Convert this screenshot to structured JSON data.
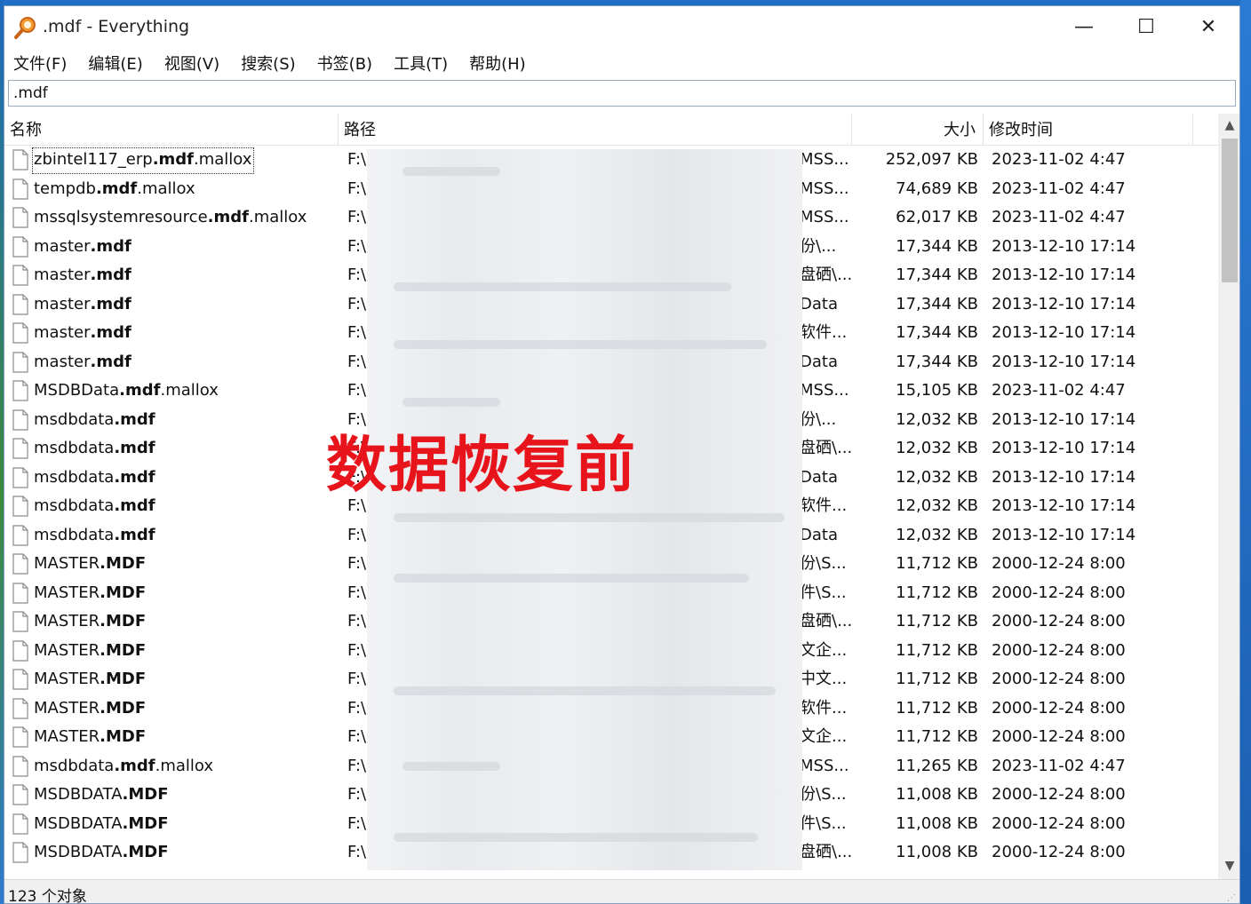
{
  "window": {
    "title": ".mdf - Everything",
    "controls": {
      "minimize": "—",
      "maximize": "☐",
      "close": "✕"
    }
  },
  "menu": [
    "文件(F)",
    "编辑(E)",
    "视图(V)",
    "搜索(S)",
    "书签(B)",
    "工具(T)",
    "帮助(H)"
  ],
  "search": {
    "value": ".mdf"
  },
  "columns": {
    "name": "名称",
    "path": "路径",
    "size": "大小",
    "modified": "修改时间"
  },
  "rows": [
    {
      "pre": "zbintel117_erp",
      "bold": ".mdf",
      "post": ".mallox",
      "drive": "F:\\",
      "tail": "MSS...",
      "size": "252,097 KB",
      "date": "2023-11-02 4:47"
    },
    {
      "pre": "tempdb",
      "bold": ".mdf",
      "post": ".mallox",
      "drive": "F:\\",
      "tail": "MSS...",
      "size": "74,689 KB",
      "date": "2023-11-02 4:47"
    },
    {
      "pre": "mssqlsystemresource",
      "bold": ".mdf",
      "post": ".mallox",
      "drive": "F:\\",
      "tail": "MSS...",
      "size": "62,017 KB",
      "date": "2023-11-02 4:47"
    },
    {
      "pre": "master",
      "bold": ".mdf",
      "post": "",
      "drive": "F:\\",
      "tail": "份\\...",
      "size": "17,344 KB",
      "date": "2013-12-10 17:14"
    },
    {
      "pre": "master",
      "bold": ".mdf",
      "post": "",
      "drive": "F:\\",
      "tail": "盘硒\\...",
      "size": "17,344 KB",
      "date": "2013-12-10 17:14"
    },
    {
      "pre": "master",
      "bold": ".mdf",
      "post": "",
      "drive": "F:\\",
      "tail": "Data",
      "size": "17,344 KB",
      "date": "2013-12-10 17:14"
    },
    {
      "pre": "master",
      "bold": ".mdf",
      "post": "",
      "drive": "F:\\",
      "tail": "软件...",
      "size": "17,344 KB",
      "date": "2013-12-10 17:14"
    },
    {
      "pre": "master",
      "bold": ".mdf",
      "post": "",
      "drive": "F:\\",
      "tail": "Data",
      "size": "17,344 KB",
      "date": "2013-12-10 17:14"
    },
    {
      "pre": "MSDBData",
      "bold": ".mdf",
      "post": ".mallox",
      "drive": "F:\\",
      "tail": "MSS...",
      "size": "15,105 KB",
      "date": "2023-11-02 4:47"
    },
    {
      "pre": "msdbdata",
      "bold": ".mdf",
      "post": "",
      "drive": "F:\\",
      "tail": "份\\...",
      "size": "12,032 KB",
      "date": "2013-12-10 17:14"
    },
    {
      "pre": "msdbdata",
      "bold": ".mdf",
      "post": "",
      "drive": "F:\\",
      "tail": "盘硒\\...",
      "size": "12,032 KB",
      "date": "2013-12-10 17:14"
    },
    {
      "pre": "msdbdata",
      "bold": ".mdf",
      "post": "",
      "drive": "F:\\",
      "tail": "Data",
      "size": "12,032 KB",
      "date": "2013-12-10 17:14"
    },
    {
      "pre": "msdbdata",
      "bold": ".mdf",
      "post": "",
      "drive": "F:\\",
      "tail": "软件...",
      "size": "12,032 KB",
      "date": "2013-12-10 17:14"
    },
    {
      "pre": "msdbdata",
      "bold": ".mdf",
      "post": "",
      "drive": "F:\\",
      "tail": "Data",
      "size": "12,032 KB",
      "date": "2013-12-10 17:14"
    },
    {
      "pre": "MASTER",
      "bold": ".MDF",
      "post": "",
      "drive": "F:\\",
      "tail": "份\\S...",
      "size": "11,712 KB",
      "date": "2000-12-24 8:00"
    },
    {
      "pre": "MASTER",
      "bold": ".MDF",
      "post": "",
      "drive": "F:\\",
      "tail": "件\\S...",
      "size": "11,712 KB",
      "date": "2000-12-24 8:00"
    },
    {
      "pre": "MASTER",
      "bold": ".MDF",
      "post": "",
      "drive": "F:\\",
      "tail": "盘硒\\...",
      "size": "11,712 KB",
      "date": "2000-12-24 8:00"
    },
    {
      "pre": "MASTER",
      "bold": ".MDF",
      "post": "",
      "drive": "F:\\",
      "tail": "文企...",
      "size": "11,712 KB",
      "date": "2000-12-24 8:00"
    },
    {
      "pre": "MASTER",
      "bold": ".MDF",
      "post": "",
      "drive": "F:\\",
      "tail": "中文...",
      "size": "11,712 KB",
      "date": "2000-12-24 8:00"
    },
    {
      "pre": "MASTER",
      "bold": ".MDF",
      "post": "",
      "drive": "F:\\",
      "tail": "软件...",
      "size": "11,712 KB",
      "date": "2000-12-24 8:00"
    },
    {
      "pre": "MASTER",
      "bold": ".MDF",
      "post": "",
      "drive": "F:\\",
      "tail": "文企...",
      "size": "11,712 KB",
      "date": "2000-12-24 8:00"
    },
    {
      "pre": "msdbdata",
      "bold": ".mdf",
      "post": ".mallox",
      "drive": "F:\\",
      "tail": "MSS...",
      "size": "11,265 KB",
      "date": "2023-11-02 4:47"
    },
    {
      "pre": "MSDBDATA",
      "bold": ".MDF",
      "post": "",
      "drive": "F:\\",
      "tail": "份\\S...",
      "size": "11,008 KB",
      "date": "2000-12-24 8:00"
    },
    {
      "pre": "MSDBDATA",
      "bold": ".MDF",
      "post": "",
      "drive": "F:\\",
      "tail": "件\\S...",
      "size": "11,008 KB",
      "date": "2000-12-24 8:00"
    },
    {
      "pre": "MSDBDATA",
      "bold": ".MDF",
      "post": "",
      "drive": "F:\\",
      "tail": "盘硒\\...",
      "size": "11,008 KB",
      "date": "2000-12-24 8:00"
    }
  ],
  "overlay": {
    "watermark": "数据恢复前",
    "color": "#e8141c"
  },
  "status": {
    "text": "123 个对象"
  },
  "icons": {
    "app": "search-magnifier-icon",
    "file": "file-icon"
  }
}
